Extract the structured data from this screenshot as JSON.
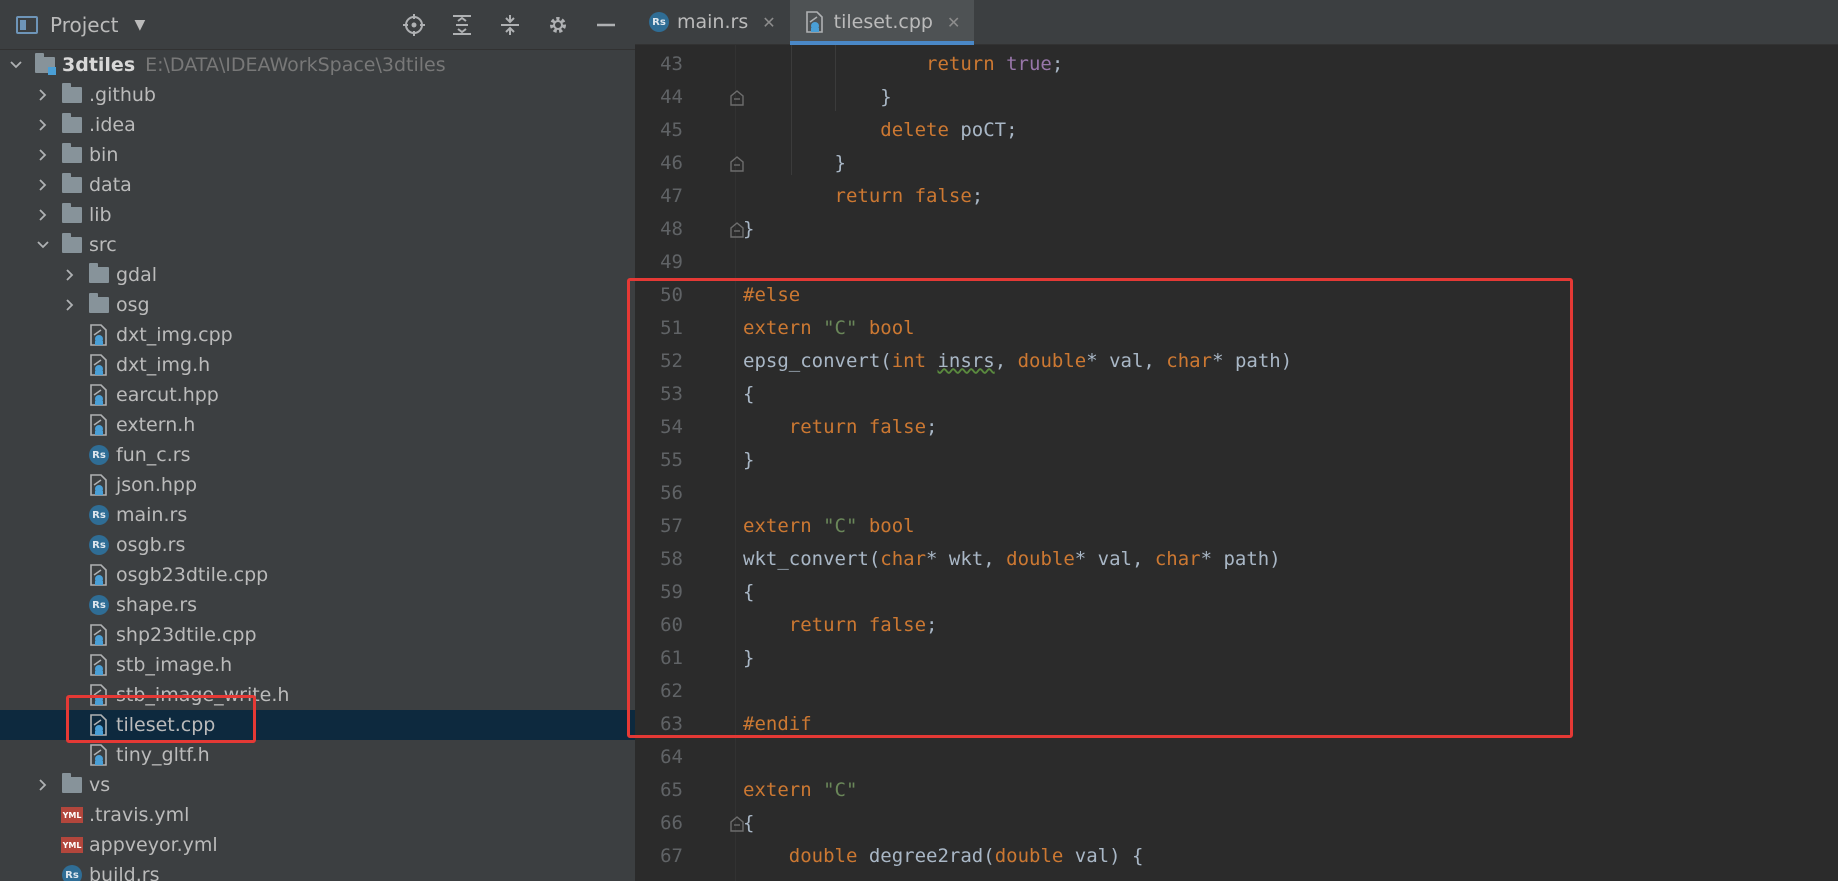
{
  "project_panel": {
    "title": "Project",
    "actions": [
      "locate-icon",
      "expand-all-icon",
      "collapse-all-icon",
      "gear-icon",
      "hide-icon"
    ],
    "root": {
      "name": "3dtiles",
      "path": "E:\\DATA\\IDEAWorkSpace\\3dtiles"
    },
    "items": [
      {
        "label": ".github",
        "type": "folder",
        "depth": 1,
        "expanded": false
      },
      {
        "label": ".idea",
        "type": "folder",
        "depth": 1,
        "expanded": false
      },
      {
        "label": "bin",
        "type": "folder",
        "depth": 1,
        "expanded": false
      },
      {
        "label": "data",
        "type": "folder",
        "depth": 1,
        "expanded": false
      },
      {
        "label": "lib",
        "type": "folder",
        "depth": 1,
        "expanded": false
      },
      {
        "label": "src",
        "type": "folder",
        "depth": 1,
        "expanded": true
      },
      {
        "label": "gdal",
        "type": "folder",
        "depth": 2,
        "expanded": false
      },
      {
        "label": "osg",
        "type": "folder",
        "depth": 2,
        "expanded": false
      },
      {
        "label": "dxt_img.cpp",
        "type": "cpp",
        "depth": 2
      },
      {
        "label": "dxt_img.h",
        "type": "cpp",
        "depth": 2
      },
      {
        "label": "earcut.hpp",
        "type": "cpp",
        "depth": 2
      },
      {
        "label": "extern.h",
        "type": "cpp",
        "depth": 2
      },
      {
        "label": "fun_c.rs",
        "type": "rs",
        "depth": 2
      },
      {
        "label": "json.hpp",
        "type": "cpp",
        "depth": 2
      },
      {
        "label": "main.rs",
        "type": "rs",
        "depth": 2
      },
      {
        "label": "osgb.rs",
        "type": "rs",
        "depth": 2
      },
      {
        "label": "osgb23dtile.cpp",
        "type": "cpp",
        "depth": 2
      },
      {
        "label": "shape.rs",
        "type": "rs",
        "depth": 2
      },
      {
        "label": "shp23dtile.cpp",
        "type": "cpp",
        "depth": 2
      },
      {
        "label": "stb_image.h",
        "type": "cpp",
        "depth": 2
      },
      {
        "label": "stb_image_write.h",
        "type": "cpp",
        "depth": 2
      },
      {
        "label": "tileset.cpp",
        "type": "cpp",
        "depth": 2,
        "selected": true
      },
      {
        "label": "tiny_gltf.h",
        "type": "cpp",
        "depth": 2
      },
      {
        "label": "vs",
        "type": "folder",
        "depth": 1,
        "expanded": false
      },
      {
        "label": ".travis.yml",
        "type": "yml",
        "depth": 1
      },
      {
        "label": "appveyor.yml",
        "type": "yml",
        "depth": 1
      },
      {
        "label": "build.rs",
        "type": "rs",
        "depth": 1
      }
    ]
  },
  "editor": {
    "tabs": [
      {
        "label": "main.rs",
        "icon": "rust-file-icon",
        "active": false
      },
      {
        "label": "tileset.cpp",
        "icon": "cpp-file-icon",
        "active": true
      }
    ],
    "lines": [
      {
        "num": "43",
        "tokens": [
          [
            "",
            "                "
          ],
          [
            "kw",
            "return "
          ],
          [
            "tru",
            "true"
          ],
          [
            "",
            ";"
          ]
        ]
      },
      {
        "num": "44",
        "tokens": [
          [
            "",
            "            }"
          ]
        ],
        "fold": true
      },
      {
        "num": "45",
        "tokens": [
          [
            "",
            "            "
          ],
          [
            "kw",
            "delete "
          ],
          [
            "",
            "poCT;"
          ]
        ]
      },
      {
        "num": "46",
        "tokens": [
          [
            "",
            "        }"
          ]
        ],
        "fold": true
      },
      {
        "num": "47",
        "tokens": [
          [
            "",
            "        "
          ],
          [
            "kw",
            "return false"
          ],
          [
            "",
            ";"
          ]
        ]
      },
      {
        "num": "48",
        "tokens": [
          [
            "",
            "}"
          ]
        ],
        "fold": true
      },
      {
        "num": "49",
        "tokens": [
          [
            "",
            ""
          ]
        ]
      },
      {
        "num": "50",
        "tokens": [
          [
            "prekw",
            "#else"
          ]
        ]
      },
      {
        "num": "51",
        "tokens": [
          [
            "kw",
            "extern "
          ],
          [
            "str",
            "\"C\" "
          ],
          [
            "kw",
            "bool"
          ]
        ]
      },
      {
        "num": "52",
        "tokens": [
          [
            "",
            "epsg_convert("
          ],
          [
            "kw",
            "int "
          ],
          [
            "warn",
            "insrs"
          ],
          [
            "",
            ", "
          ],
          [
            "kw",
            "double"
          ],
          [
            "",
            "* val, "
          ],
          [
            "kw",
            "char"
          ],
          [
            "",
            "* path)"
          ]
        ]
      },
      {
        "num": "53",
        "tokens": [
          [
            "",
            "{"
          ]
        ]
      },
      {
        "num": "54",
        "tokens": [
          [
            "",
            "    "
          ],
          [
            "kw",
            "return false"
          ],
          [
            "",
            ";"
          ]
        ]
      },
      {
        "num": "55",
        "tokens": [
          [
            "",
            "}"
          ]
        ]
      },
      {
        "num": "56",
        "tokens": [
          [
            "",
            ""
          ]
        ]
      },
      {
        "num": "57",
        "tokens": [
          [
            "kw",
            "extern "
          ],
          [
            "str",
            "\"C\" "
          ],
          [
            "kw",
            "bool"
          ]
        ]
      },
      {
        "num": "58",
        "tokens": [
          [
            "",
            "wkt_convert("
          ],
          [
            "kw",
            "char"
          ],
          [
            "",
            "* wkt, "
          ],
          [
            "kw",
            "double"
          ],
          [
            "",
            "* val, "
          ],
          [
            "kw",
            "char"
          ],
          [
            "",
            "* path)"
          ]
        ]
      },
      {
        "num": "59",
        "tokens": [
          [
            "",
            "{"
          ]
        ]
      },
      {
        "num": "60",
        "tokens": [
          [
            "",
            "    "
          ],
          [
            "kw",
            "return false"
          ],
          [
            "",
            ";"
          ]
        ]
      },
      {
        "num": "61",
        "tokens": [
          [
            "",
            "}"
          ]
        ]
      },
      {
        "num": "62",
        "tokens": [
          [
            "",
            ""
          ]
        ]
      },
      {
        "num": "63",
        "tokens": [
          [
            "prekw",
            "#endif"
          ]
        ]
      },
      {
        "num": "64",
        "tokens": [
          [
            "",
            ""
          ]
        ]
      },
      {
        "num": "65",
        "tokens": [
          [
            "kw",
            "extern "
          ],
          [
            "str",
            "\"C\""
          ]
        ]
      },
      {
        "num": "66",
        "tokens": [
          [
            "",
            "{"
          ]
        ],
        "fold": true
      },
      {
        "num": "67",
        "tokens": [
          [
            "",
            "    "
          ],
          [
            "kw",
            "double "
          ],
          [
            "",
            "degree2rad("
          ],
          [
            "kw",
            "double "
          ],
          [
            "",
            "val) {"
          ]
        ]
      }
    ]
  }
}
